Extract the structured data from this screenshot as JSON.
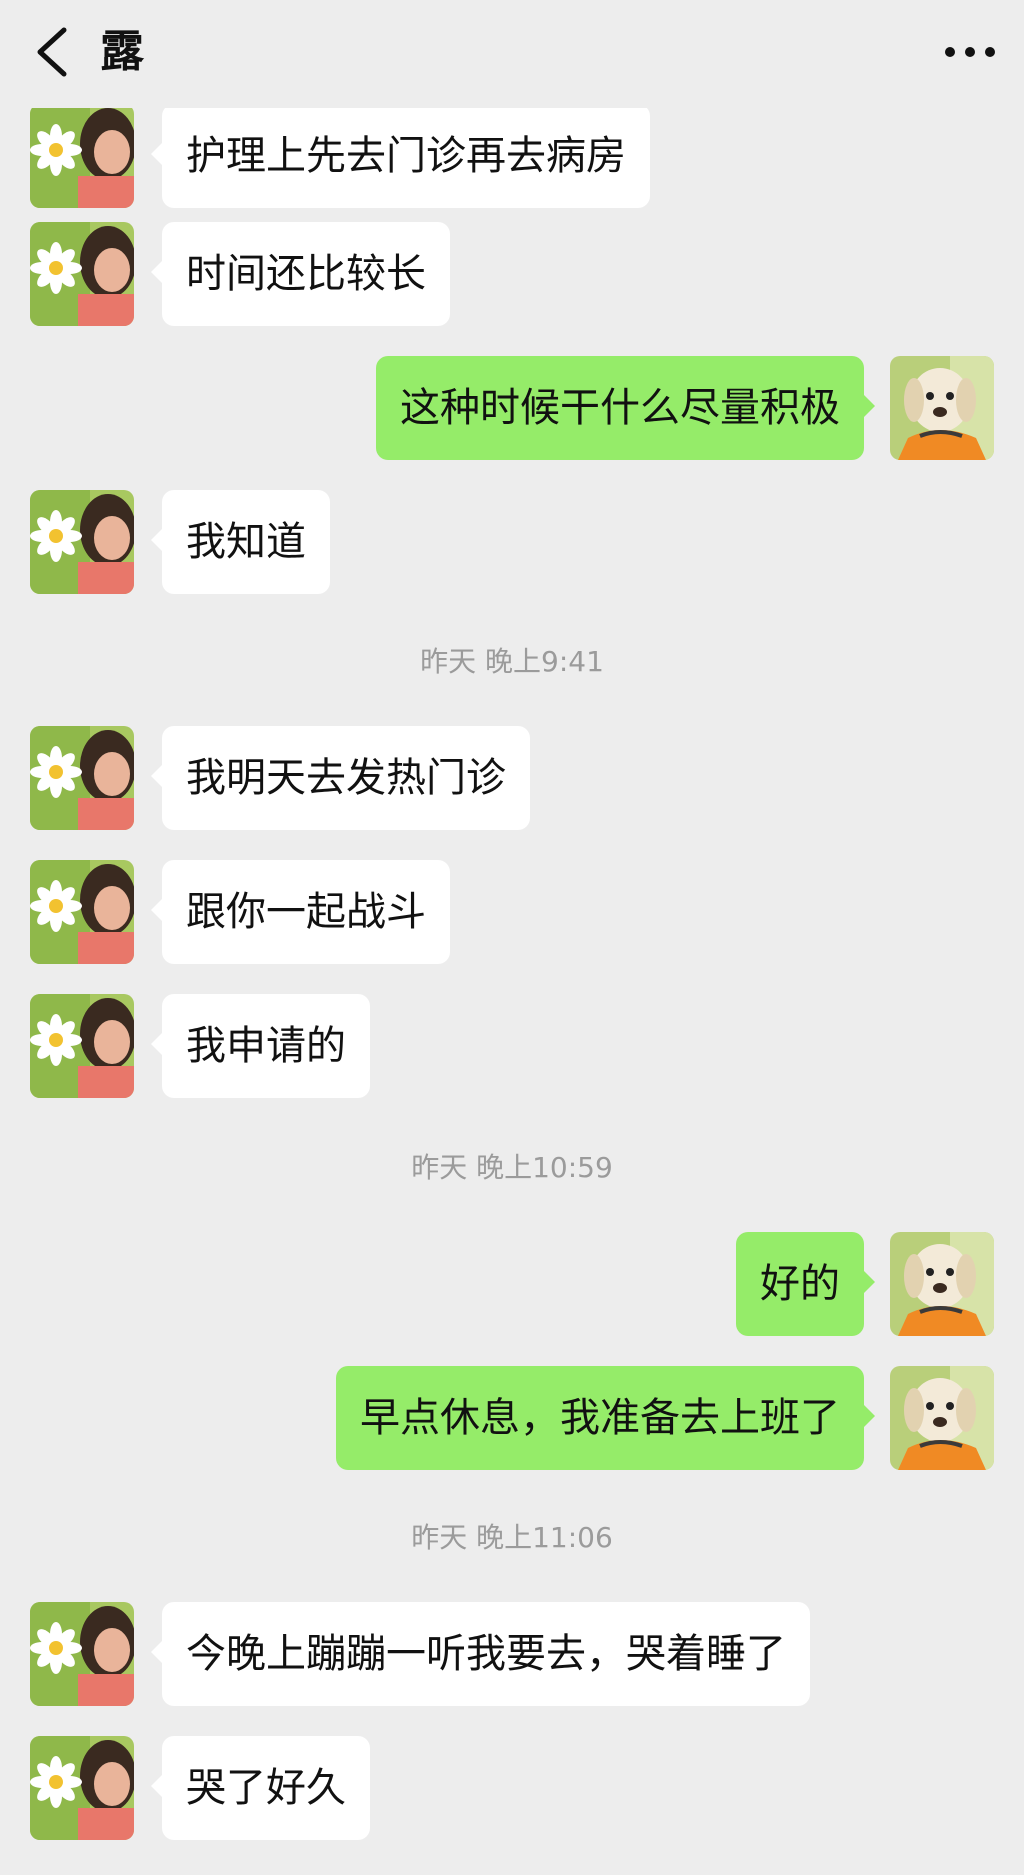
{
  "header": {
    "back_icon": "chevron-left-icon",
    "title": "露",
    "more_icon": "more-horizontal-icon"
  },
  "colors": {
    "background": "#ededed",
    "incoming_bubble": "#ffffff",
    "outgoing_bubble": "#95ec69",
    "timestamp_text": "#9b9b9b"
  },
  "messages": [
    {
      "side": "left",
      "text": "护理上先去门诊再去病房"
    },
    {
      "side": "left",
      "text": "时间还比较长"
    },
    {
      "side": "right",
      "text": "这种时候干什么尽量积极"
    },
    {
      "side": "left",
      "text": "我知道"
    },
    {
      "timestamp": "昨天 晚上9:41"
    },
    {
      "side": "left",
      "text": "我明天去发热门诊"
    },
    {
      "side": "left",
      "text": "跟你一起战斗"
    },
    {
      "side": "left",
      "text": "我申请的"
    },
    {
      "timestamp": "昨天 晚上10:59"
    },
    {
      "side": "right",
      "text": "好的"
    },
    {
      "side": "right",
      "text": "早点休息，我准备去上班了"
    },
    {
      "timestamp": "昨天 晚上11:06"
    },
    {
      "side": "left",
      "text": "今晚上蹦蹦一听我要去，哭着睡了"
    },
    {
      "side": "left",
      "text": "哭了好久"
    }
  ]
}
